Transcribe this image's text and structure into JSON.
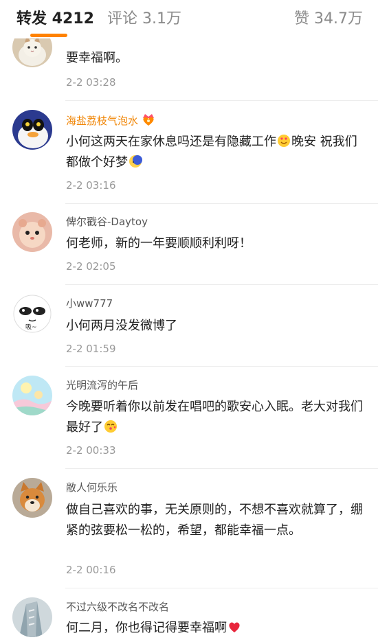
{
  "tabs": {
    "repost": "转发 4212",
    "comments": "评论 3.1万",
    "likes": "赞 34.7万"
  },
  "colors": {
    "accent": "#ff8200",
    "vip_name": "#f08300"
  },
  "comments": [
    {
      "user": "",
      "content": "要幸福啊。",
      "time": "2-2 03:28",
      "avatar": "cat-avatar"
    },
    {
      "user": "海盐荔枝气泡水",
      "vip": true,
      "badge_icon": "crown-heart-badge-icon",
      "content_parts": [
        "小何这两天在家休息吗还是有隐藏工作",
        "晚安 祝我们都做个好梦"
      ],
      "emojis": [
        "heart-eyes-emoji-icon",
        "moon-emoji-icon"
      ],
      "time": "2-2 03:16",
      "avatar": "cartoon-duck-avatar"
    },
    {
      "user": "俾尔戳谷-Daytoy",
      "content": "何老师，新的一年要顺顺利利呀！",
      "time": "2-2 02:05",
      "avatar": "hamster-avatar"
    },
    {
      "user": "小ww777",
      "content": "小何两月没发微博了",
      "time": "2-2 01:59",
      "avatar": "doodle-face-avatar",
      "avatar_text": "吸~"
    },
    {
      "user": "光明流泻的午后",
      "content": "今晚要听着你以前发在唱吧的歌安心入眠。老大对我们最好了",
      "emojis": [
        "kiss-emoji-icon"
      ],
      "time": "2-2 00:33",
      "avatar": "pastel-illustration-avatar"
    },
    {
      "user": "敝人何乐乐",
      "content": "做自己喜欢的事，无关原则的，不想不喜欢就算了，绷紧的弦要松一松的，希望，都能幸福一点。",
      "time": "2-2 00:16",
      "avatar": "shiba-dog-avatar"
    },
    {
      "user": "不过六级不改名不改名",
      "content": "何二月，你也得记得要幸福啊",
      "emojis": [
        "red-heart-emoji-icon"
      ],
      "time": "",
      "avatar": "building-photo-avatar"
    }
  ]
}
